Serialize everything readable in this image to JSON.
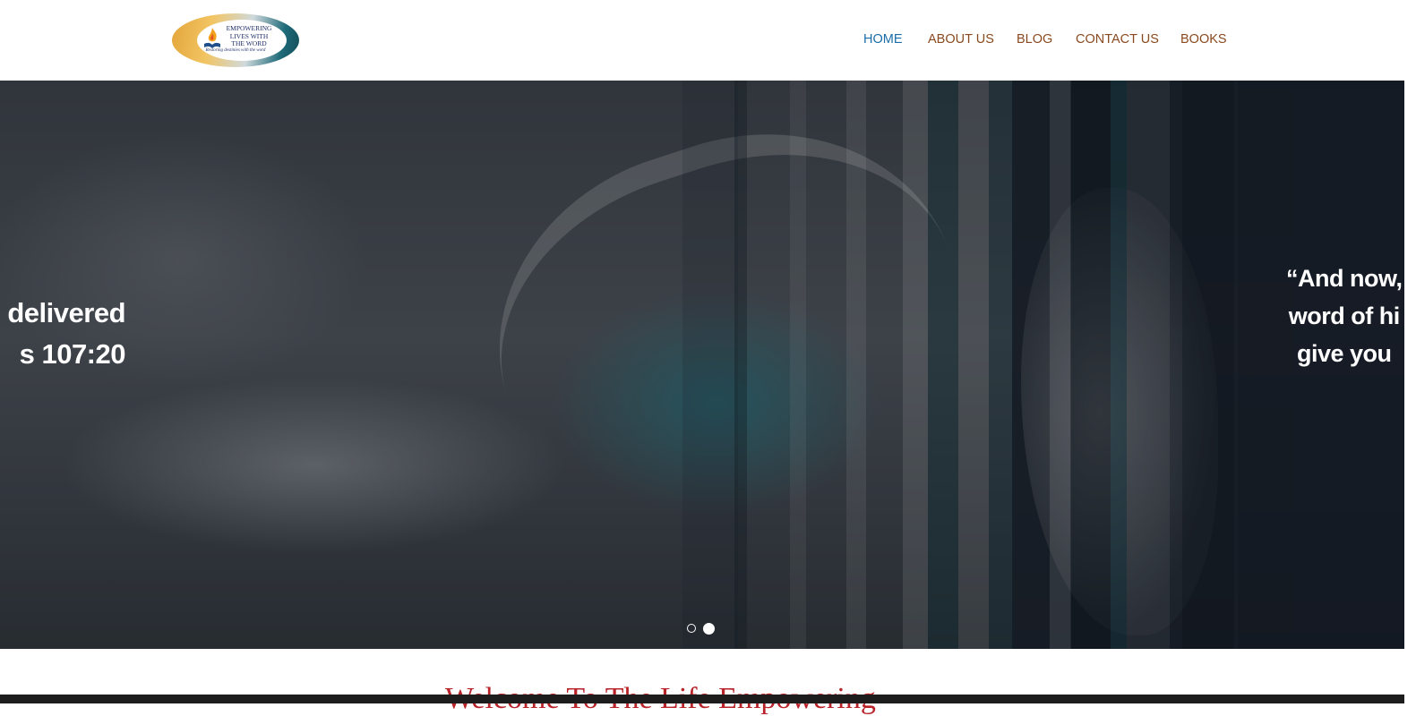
{
  "header": {
    "logo": {
      "lines": [
        "EMPOWERING",
        "LIVES WITH",
        "THE WORD"
      ],
      "tagline": "Restoring destinies with the word"
    },
    "nav": [
      {
        "label": "HOME",
        "active": true
      },
      {
        "label": "ABOUT US",
        "active": false
      },
      {
        "label": "BLOG",
        "active": false
      },
      {
        "label": "CONTACT US",
        "active": false
      },
      {
        "label": "BOOKS",
        "active": false
      }
    ]
  },
  "hero": {
    "slide_left": {
      "line1": "delivered",
      "line2": "s 107:20"
    },
    "slide_right": {
      "line1": "“And now,",
      "line2": "word of hi",
      "line3": "give you"
    },
    "dots": {
      "count": 2,
      "active_index": 1
    }
  },
  "welcome": {
    "heading": "Welcome To The Life Empowering"
  },
  "colors": {
    "nav_text": "#8a4a1f",
    "nav_active": "#1a6da8",
    "welcome": "#b8232a"
  }
}
